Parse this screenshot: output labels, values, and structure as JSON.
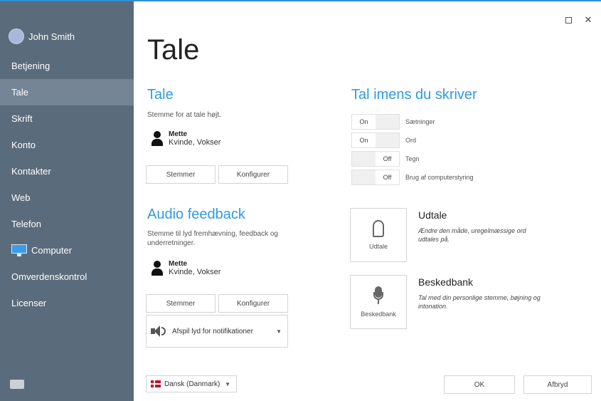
{
  "window": {
    "maximize_icon": "maximize-icon",
    "close_label": "✕"
  },
  "sidebar": {
    "user_name": "John Smith",
    "items": [
      {
        "label": "Betjening"
      },
      {
        "label": "Tale",
        "active": true
      },
      {
        "label": "Skrift"
      },
      {
        "label": "Konto"
      },
      {
        "label": "Kontakter"
      },
      {
        "label": "Web"
      },
      {
        "label": "Telefon"
      },
      {
        "label": "Computer",
        "icon": "monitor-icon"
      },
      {
        "label": "Omverdenskontrol"
      },
      {
        "label": "Licenser"
      }
    ]
  },
  "main": {
    "title": "Tale",
    "tale": {
      "heading": "Tale",
      "description": "Stemme for at tale højt.",
      "voice_name": "Mette",
      "voice_meta": "Kvinde, Vokser",
      "voices_button": "Stemmer",
      "configure_button": "Konfigurer"
    },
    "audio_feedback": {
      "heading": "Audio feedback",
      "description": "Stemme til lyd fremhævning, feedback og underretninger.",
      "voice_name": "Mette",
      "voice_meta": "Kvinde, Vokser",
      "voices_button": "Stemmer",
      "configure_button": "Konfigurer",
      "notification_select": "Afspil lyd for notifikationer"
    },
    "speak_while_typing": {
      "heading": "Tal imens du skriver",
      "toggles": [
        {
          "label": "Sætninger",
          "state": "On"
        },
        {
          "label": "Ord",
          "state": "On"
        },
        {
          "label": "Tegn",
          "state": "Off"
        },
        {
          "label": "Brug af computerstyring",
          "state": "Off"
        }
      ]
    },
    "pronunciation": {
      "tile_label": "Udtale",
      "title": "Udtale",
      "description": "Ændre den måde, uregelmæssige ord udtales på."
    },
    "message_bank": {
      "tile_label": "Beskedbank",
      "title": "Beskedbank",
      "description": "Tal med din personlige stemme, bøjning og intonation."
    }
  },
  "footer": {
    "language": "Dansk (Danmark)",
    "ok_button": "OK",
    "cancel_button": "Afbryd"
  },
  "colors": {
    "accent": "#2e9be0",
    "sidebar": "#5a6b7b",
    "sidebar_active": "#758595"
  }
}
